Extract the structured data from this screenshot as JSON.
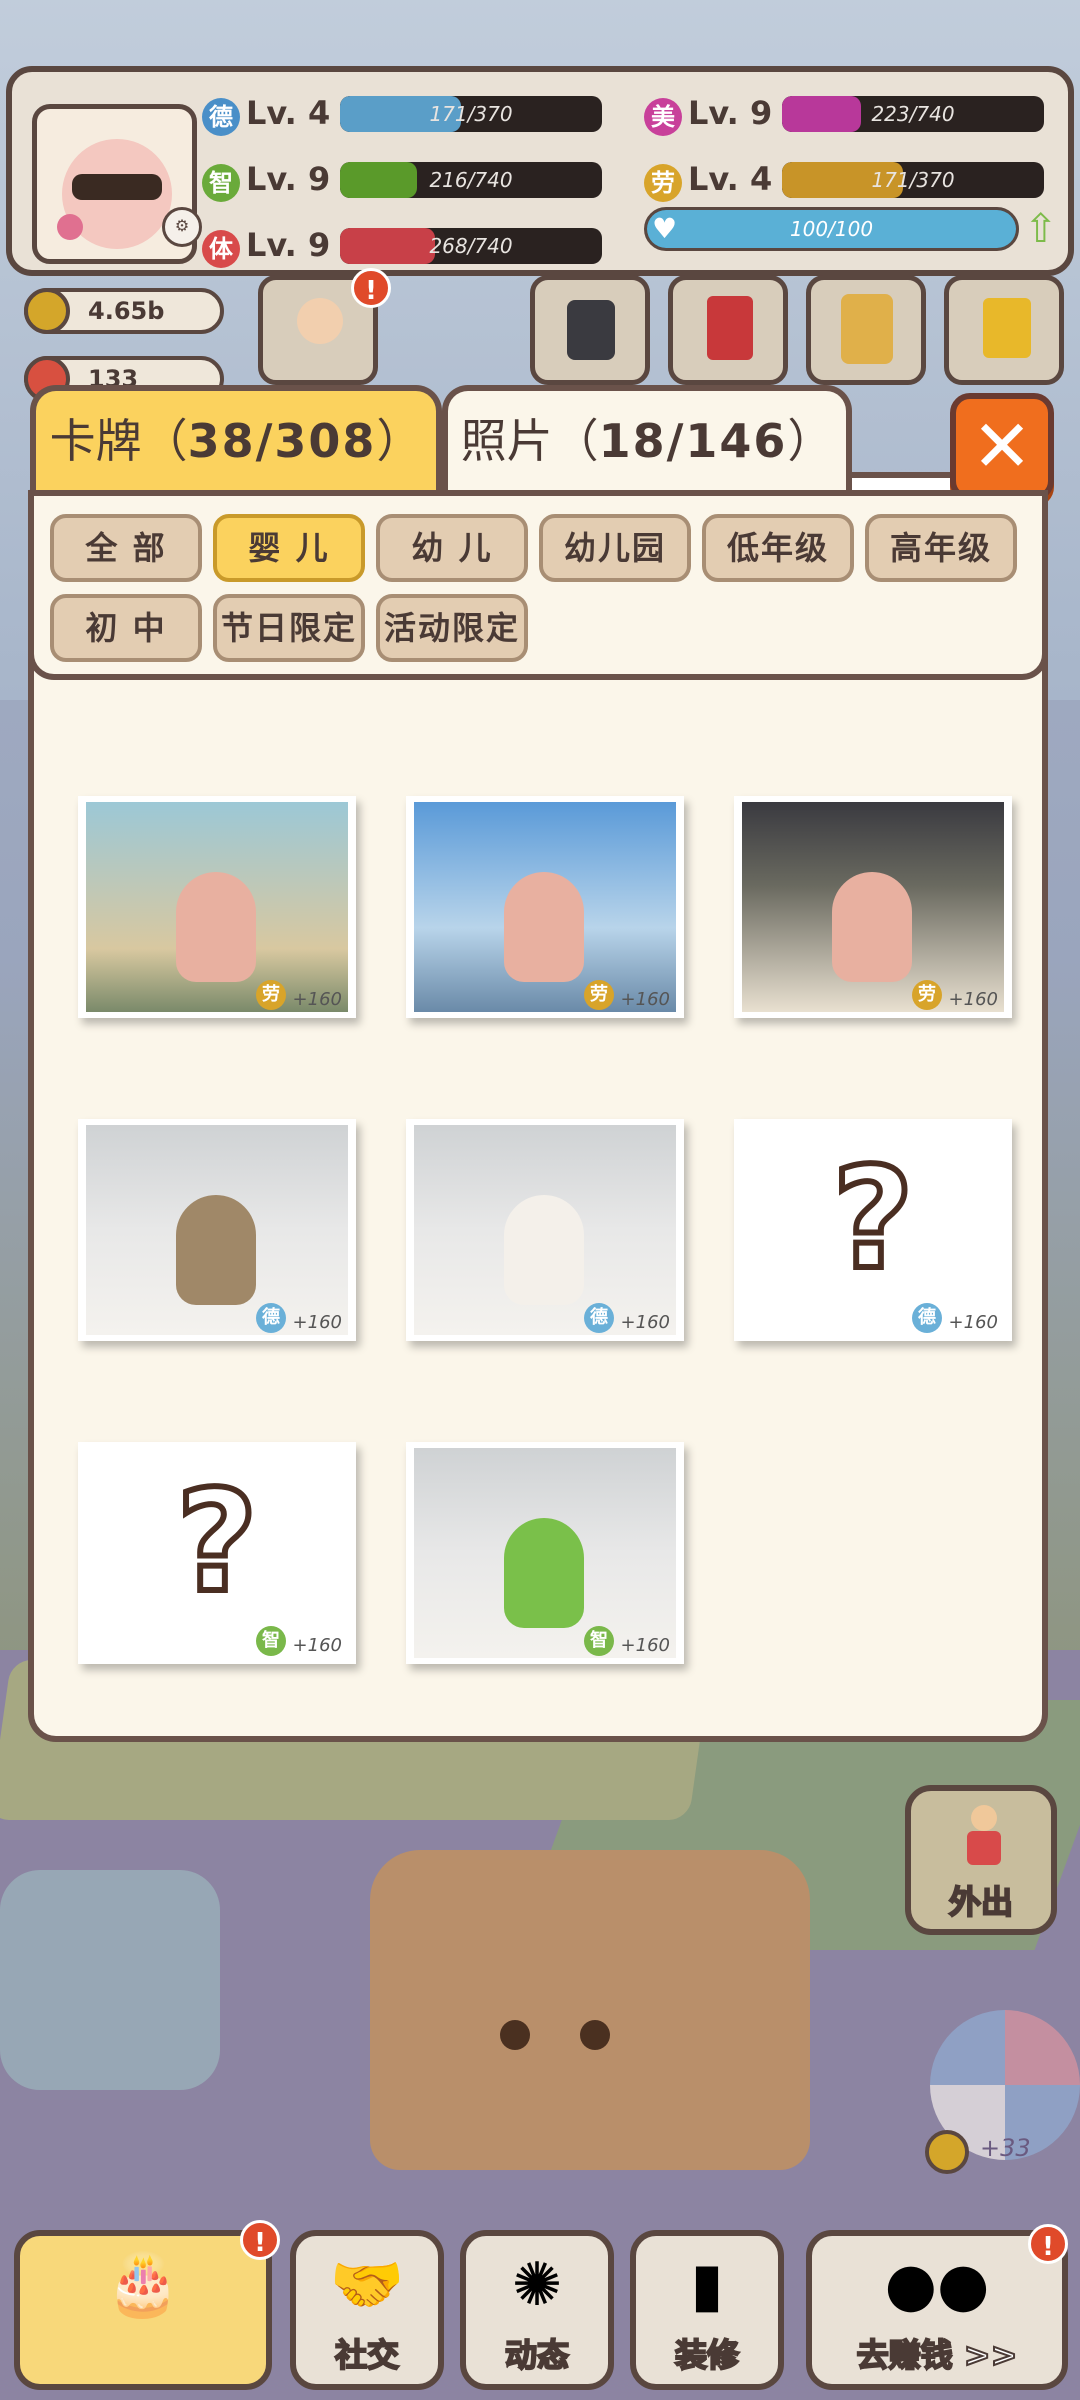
{
  "stats": [
    {
      "glyph": "德",
      "color": "#4a8fc8",
      "level": "Lv. 4",
      "bar_text": "171/370",
      "fill": 0.462,
      "bar_color": "#5a9ec8"
    },
    {
      "glyph": "智",
      "color": "#6aaa3a",
      "level": "Lv. 9",
      "bar_text": "216/740",
      "fill": 0.292,
      "bar_color": "#5a9a2a"
    },
    {
      "glyph": "体",
      "color": "#d84a4a",
      "level": "Lv. 9",
      "bar_text": "268/740",
      "fill": 0.362,
      "bar_color": "#c84048"
    },
    {
      "glyph": "美",
      "color": "#c8409a",
      "level": "Lv. 9",
      "bar_text": "223/740",
      "fill": 0.301,
      "bar_color": "#b8389a"
    },
    {
      "glyph": "劳",
      "color": "#d8a42a",
      "level": "Lv. 4",
      "bar_text": "171/370",
      "fill": 0.462,
      "bar_color": "#c89428"
    }
  ],
  "health": {
    "text": "100/100",
    "fill": 1.0
  },
  "currency": {
    "coins": "4.65b",
    "gems": "133"
  },
  "tabs": {
    "cards": {
      "label": "卡牌（",
      "count": "38/308",
      "close": "）"
    },
    "photos": {
      "label": "照片（",
      "count": "18/146",
      "close": "）"
    }
  },
  "filters": [
    {
      "label": "全 部",
      "active": false
    },
    {
      "label": "婴 儿",
      "active": true
    },
    {
      "label": "幼 儿",
      "active": false
    },
    {
      "label": "幼儿园",
      "active": false
    },
    {
      "label": "低年级",
      "active": false
    },
    {
      "label": "高年级",
      "active": false
    },
    {
      "label": "初 中",
      "active": false
    },
    {
      "label": "节日限定",
      "active": false
    },
    {
      "label": "活动限定",
      "active": false
    }
  ],
  "cards": [
    {
      "scene": "eiffel",
      "stat": "劳",
      "stat_color": "#d8a42a",
      "bonus": "+160"
    },
    {
      "scene": "liberty",
      "stat": "劳",
      "stat_color": "#d8a42a",
      "bonus": "+160"
    },
    {
      "scene": "daycare",
      "stat": "劳",
      "stat_color": "#d8a42a",
      "bonus": "+160"
    },
    {
      "scene": "bear",
      "stat": "德",
      "stat_color": "#6ab0d8",
      "bonus": "+160"
    },
    {
      "scene": "chef",
      "stat": "德",
      "stat_color": "#6ab0d8",
      "bonus": "+160"
    },
    {
      "scene": "unknown",
      "stat": "德",
      "stat_color": "#6ab0d8",
      "bonus": "+160"
    },
    {
      "scene": "unknown",
      "stat": "智",
      "stat_color": "#7ab84a",
      "bonus": "+160"
    },
    {
      "scene": "dino",
      "stat": "智",
      "stat_color": "#7ab84a",
      "bonus": "+160"
    }
  ],
  "side": {
    "out_label": "外出"
  },
  "ball_count": "+33",
  "nav": [
    {
      "label": "",
      "icon": "cake-icon"
    },
    {
      "label": "社交",
      "icon": "handshake-icon"
    },
    {
      "label": "动态",
      "icon": "pinwheel-icon"
    },
    {
      "label": "装修",
      "icon": "paint-roller-icon"
    },
    {
      "label": "去赚钱 >>",
      "icon": "gold-coins-icon"
    }
  ],
  "unknown_mark": "?",
  "close_glyph": "✕"
}
